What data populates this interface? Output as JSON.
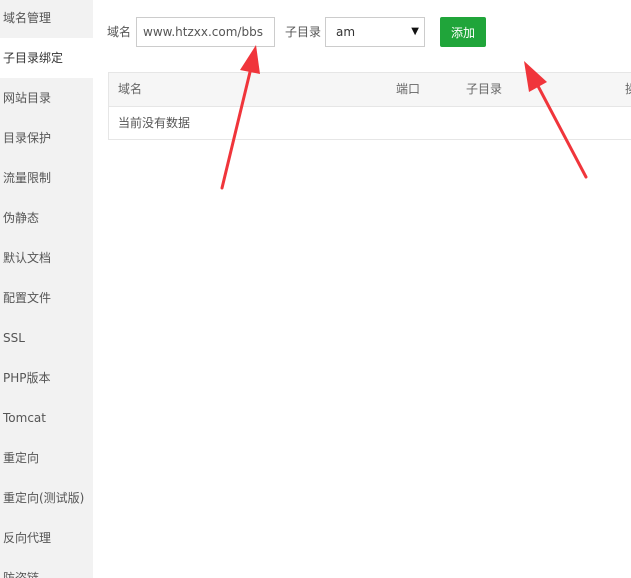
{
  "sidebar": {
    "items": [
      {
        "label": "域名管理",
        "active": false
      },
      {
        "label": "子目录绑定",
        "active": true
      },
      {
        "label": "网站目录",
        "active": false
      },
      {
        "label": "目录保护",
        "active": false
      },
      {
        "label": "流量限制",
        "active": false
      },
      {
        "label": "伪静态",
        "active": false
      },
      {
        "label": "默认文档",
        "active": false
      },
      {
        "label": "配置文件",
        "active": false
      },
      {
        "label": "SSL",
        "active": false
      },
      {
        "label": "PHP版本",
        "active": false
      },
      {
        "label": "Tomcat",
        "active": false
      },
      {
        "label": "重定向",
        "active": false
      },
      {
        "label": "重定向(测试版)",
        "active": false
      },
      {
        "label": "反向代理",
        "active": false
      },
      {
        "label": "防盗链",
        "active": false
      }
    ]
  },
  "form": {
    "domain_label": "域名",
    "domain_value": "www.htzxx.com/bbs",
    "subdir_label": "子目录",
    "subdir_selected": "am",
    "add_button": "添加"
  },
  "table": {
    "headers": [
      "域名",
      "端口",
      "子目录",
      "操作"
    ],
    "empty_text": "当前没有数据"
  },
  "colors": {
    "accent": "#20a53a",
    "arrow": "#f0353b"
  }
}
